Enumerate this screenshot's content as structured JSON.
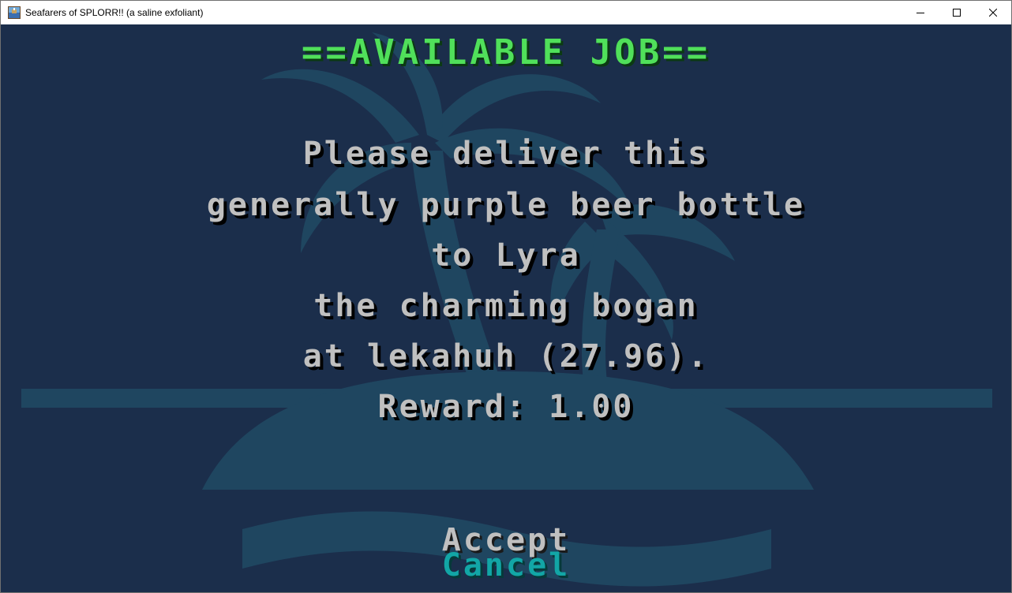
{
  "window": {
    "title": "Seafarers of SPLORR!! (a saline exfoliant)"
  },
  "game": {
    "heading": "==AVAILABLE JOB==",
    "job_lines": [
      "Please deliver this",
      "generally purple beer bottle",
      "to Lyra",
      "the charming bogan",
      "at lekahuh (27.96)."
    ],
    "reward_label": "Reward:",
    "reward_value": "1.00",
    "menu": {
      "accept": "Accept",
      "cancel": "Cancel",
      "selected": "Cancel"
    }
  },
  "colors": {
    "background": "#1b2e4b",
    "watermark": "#1f4660",
    "heading": "#50e05a",
    "body_text": "#c0c0c0",
    "selected_menu": "#12a6a6"
  },
  "icons": {
    "app": "app-icon",
    "minimize": "minimize-icon",
    "maximize": "maximize-icon",
    "close": "close-icon",
    "background_art": "palm-island-icon"
  }
}
